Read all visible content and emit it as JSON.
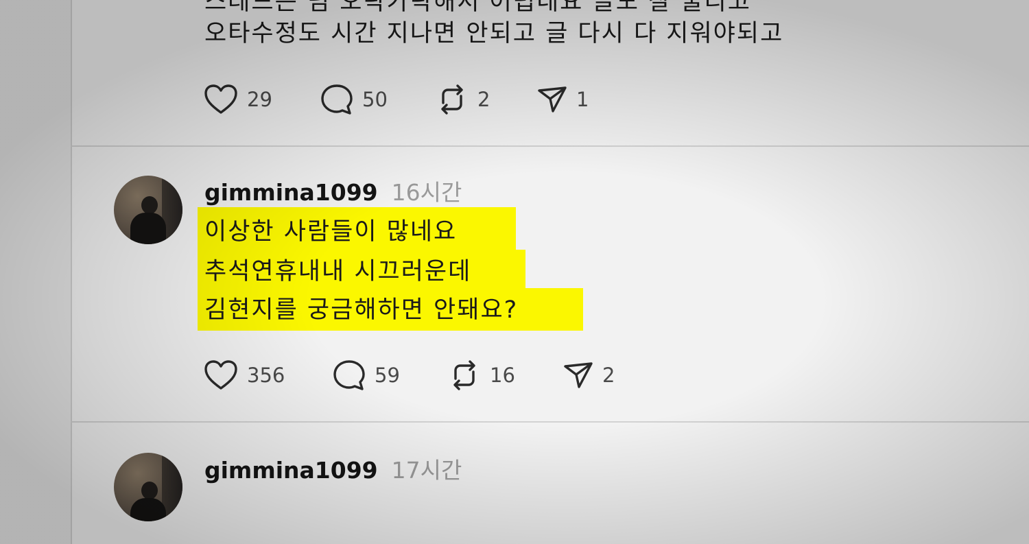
{
  "posts": [
    {
      "text_lines": [
        "스레드는 넘 오락가락해서 어렵네요 글도 잘 눌리고",
        "오타수정도 시간 지나면 안되고 글 다시 다 지워야되고"
      ],
      "actions": {
        "likes": "29",
        "replies": "50",
        "reposts": "2",
        "shares": "1"
      }
    },
    {
      "username": "gimmina1099",
      "time": "16시간",
      "text_lines": [
        "이상한 사람들이 많네요",
        "추석연휴내내 시끄러운데",
        "김현지를 궁금해하면 안돼요?"
      ],
      "highlight_color": "#FBF700",
      "actions": {
        "likes": "356",
        "replies": "59",
        "reposts": "16",
        "shares": "2"
      }
    },
    {
      "username": "gimmina1099",
      "time": "17시간"
    }
  ],
  "icons": {
    "like": "heart-icon",
    "reply": "comment-bubble-icon",
    "repost": "repost-icon",
    "share": "send-icon"
  }
}
